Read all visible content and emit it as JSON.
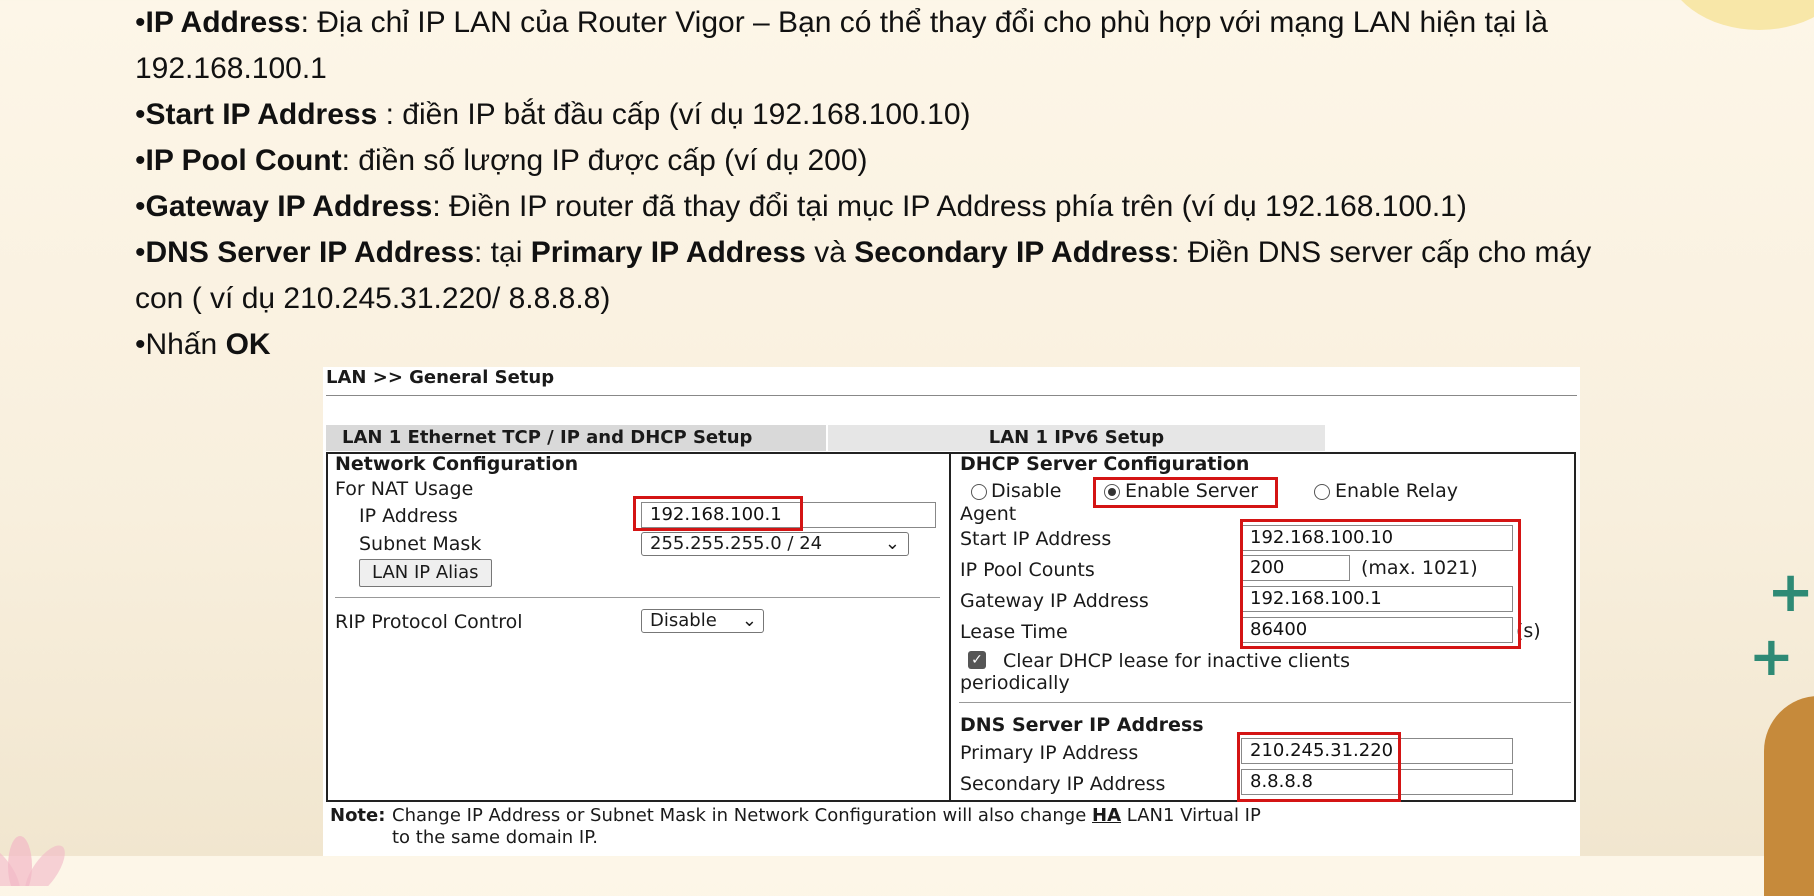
{
  "bullets": [
    {
      "bold": "IP Address",
      "rest": ": Địa chỉ IP LAN của Router Vigor – Bạn có thể thay đổi cho phù hợp với mạng LAN hiện tại là",
      "line2": "192.168.100.1"
    },
    {
      "bold": "Start IP Address",
      "rest": " : điền IP bắt đầu cấp (ví dụ 192.168.100.10)"
    },
    {
      "bold": "IP Pool Count",
      "rest": ": điền số lượng IP được cấp (ví dụ 200)"
    },
    {
      "bold": "Gateway IP Address",
      "rest": ": Điền IP router đã thay đổi tại mục IP Address phía trên (ví dụ 192.168.100.1)"
    },
    {
      "bold": "DNS Server IP Address",
      "mid1": ": tại ",
      "bold2": "Primary IP Address",
      "mid2": " và ",
      "bold3": "Secondary IP Address",
      "rest": ": Điền DNS server cấp cho máy",
      "line2": "con ( ví dụ 210.245.31.220/ 8.8.8.8)"
    },
    {
      "pre": "Nhấn ",
      "bold": "OK"
    }
  ],
  "bullet_char": "•",
  "panel": {
    "breadcrumb": "LAN >> General Setup",
    "tabs": [
      "LAN 1 Ethernet TCP / IP and DHCP Setup",
      "LAN 1 IPv6 Setup"
    ],
    "network": {
      "heading": "Network Configuration",
      "for_nat": "For NAT Usage",
      "ip_label": "IP Address",
      "ip_value": "192.168.100.1",
      "subnet_label": "Subnet Mask",
      "subnet_value": "255.255.255.0 / 24",
      "alias_button": "LAN IP Alias",
      "rip_label": "RIP Protocol Control",
      "rip_value": "Disable"
    },
    "dhcp": {
      "heading": "DHCP Server Configuration",
      "opt_disable": "Disable",
      "opt_server": "Enable Server",
      "opt_relay": "Enable Relay",
      "agent": "Agent",
      "start_label": "Start IP Address",
      "start_value": "192.168.100.10",
      "pool_label": "IP Pool Counts",
      "pool_value": "200",
      "pool_max": "(max. 1021)",
      "gateway_label": "Gateway IP Address",
      "gateway_value": "192.168.100.1",
      "lease_label": "Lease Time",
      "lease_value": "86400",
      "lease_unit": "(s)",
      "clear_line1": "Clear DHCP lease for inactive clients",
      "clear_line2": "periodically",
      "dns_heading": "DNS Server IP Address",
      "primary_label": "Primary IP Address",
      "primary_value": "210.245.31.220",
      "secondary_label": "Secondary IP Address",
      "secondary_value": "8.8.8.8"
    },
    "note": {
      "label": "Note:",
      "text_a": "Change IP Address or Subnet Mask in Network Configuration will also change ",
      "text_ha": "HA",
      "text_b": " LAN1 Virtual IP",
      "text_c": "to the same domain IP."
    }
  },
  "colors": {
    "highlight": "#d41414",
    "accent_teal": "#2e8a75"
  },
  "icons": [
    "chevron-down-icon",
    "checkbox-checked-icon",
    "radio-icon"
  ]
}
